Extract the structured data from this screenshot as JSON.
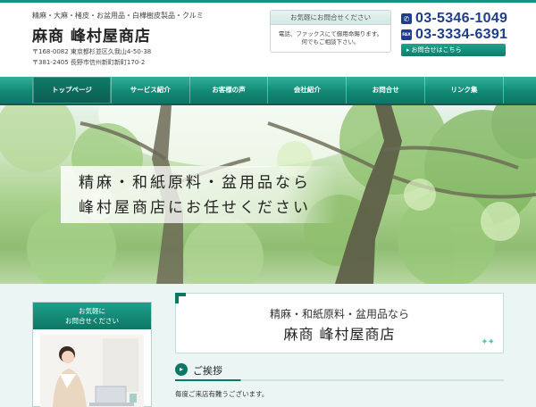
{
  "header": {
    "tagline": "精麻・大麻・楮皮・お盆用品・白樺樹皮製品・クルミ",
    "logo": "麻商 峰村屋商店",
    "address1": "〒168-0082 東京都杉並区久我山4-50-38",
    "address2": "〒381-2405 長野市信州新町新町170-2"
  },
  "contact_box": {
    "title": "お気軽にお問合せください",
    "line1": "電話、ファックスにて御用命賜ります。",
    "line2": "何でもご相談下さい。"
  },
  "phones": {
    "tel_icon": "phone-icon",
    "tel": "03-5346-1049",
    "fax_icon_label": "FAX",
    "fax": "03-3334-6391"
  },
  "inquiry_button": {
    "label": "お問合せはこちら",
    "icon": "chevron-right-icon"
  },
  "nav": {
    "items": [
      {
        "label": "トップページ"
      },
      {
        "label": "サービス紹介"
      },
      {
        "label": "お客様の声"
      },
      {
        "label": "会社紹介"
      },
      {
        "label": "お問合せ"
      },
      {
        "label": "リンク集"
      }
    ]
  },
  "hero": {
    "line1": "精麻・和紙原料・盆用品なら",
    "line2": "峰村屋商店にお任せください"
  },
  "sidebar": {
    "title_line1": "お気軽に",
    "title_line2": "お問合せください"
  },
  "welcome": {
    "line1": "精麻・和紙原料・盆用品なら",
    "line2": "麻商 峰村屋商店"
  },
  "greeting": {
    "title": "ご挨拶",
    "body": "毎度ご来店有難うございます。"
  },
  "colors": {
    "accent": "#13957f",
    "phone": "#1f3d8a"
  }
}
